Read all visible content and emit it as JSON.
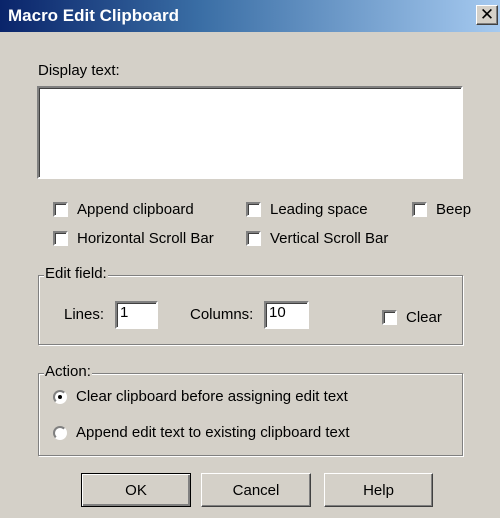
{
  "window": {
    "title": "Macro Edit Clipboard",
    "close_glyph": "✕"
  },
  "display_text": {
    "label": "Display text:",
    "value": ""
  },
  "options": [
    {
      "label": "Append clipboard",
      "checked": false
    },
    {
      "label": "Leading space",
      "checked": false
    },
    {
      "label": "Beep",
      "checked": false
    },
    {
      "label": "Horizontal Scroll Bar",
      "checked": false
    },
    {
      "label": "Vertical Scroll Bar",
      "checked": false
    }
  ],
  "edit_field": {
    "group_label": "Edit field:",
    "lines_label": "Lines:",
    "lines_value": "1",
    "columns_label": "Columns:",
    "columns_value": "10",
    "clear_label": "Clear",
    "clear_checked": false
  },
  "action": {
    "group_label": "Action:",
    "options": [
      {
        "label": "Clear clipboard before assigning edit text",
        "selected": true
      },
      {
        "label": "Append edit text to existing clipboard text",
        "selected": false
      }
    ]
  },
  "buttons": {
    "ok": "OK",
    "cancel": "Cancel",
    "help": "Help"
  }
}
